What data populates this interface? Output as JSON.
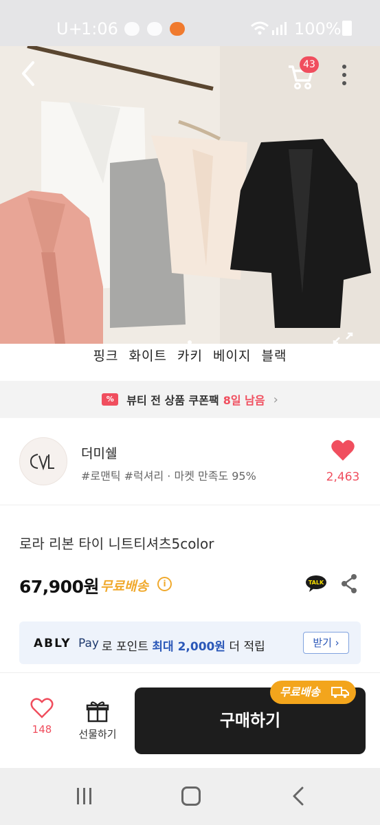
{
  "status_bar": {
    "carrier": "U+",
    "time": "1:06",
    "battery": "100%"
  },
  "header": {
    "cart_count": "43",
    "icons": [
      "back-icon",
      "cart-icon",
      "more-vertical-icon",
      "expand-icon"
    ]
  },
  "product_image": {
    "caption": "핑크 화이트 카키 베이지 블랙"
  },
  "coupon": {
    "text": "뷰티 전 상품 쿠폰팩",
    "days_left": "8일 남음"
  },
  "store": {
    "name": "더미쉘",
    "tags": "#로맨틱 #럭셔리 · 마켓 만족도 95%",
    "likes": "2,463"
  },
  "product": {
    "title": "로라 리본 타이 니트티셔츠5color",
    "price": "67,900원",
    "shipping": "무료배송"
  },
  "pay_banner": {
    "brand": "ABLY",
    "pay": "Pay",
    "text_prefix": "로 포인트 ",
    "highlight": "최대 2,000원",
    "text_suffix": " 더 적립",
    "button": "받기 ›"
  },
  "bottom_bar": {
    "wish_count": "148",
    "gift_label": "선물하기",
    "buy_label": "구매하기",
    "ship_badge": "무료배송"
  },
  "colors": {
    "accent": "#f04e5e",
    "shipping": "#f0a92c",
    "buy_button": "#1d1d1d"
  }
}
